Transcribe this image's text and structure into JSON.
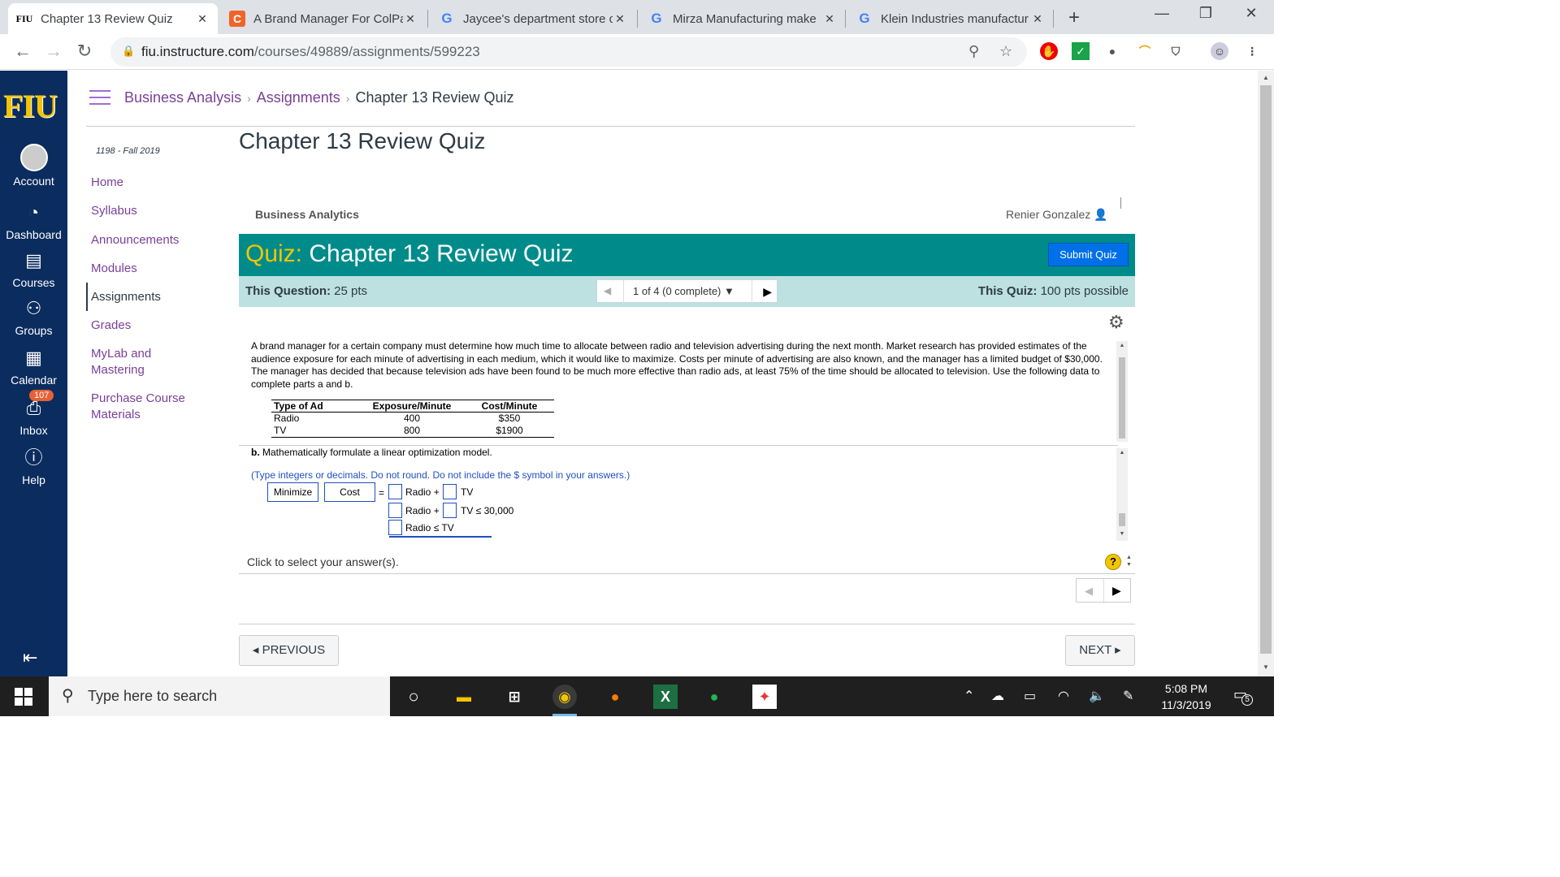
{
  "browser": {
    "tabs": [
      {
        "favicon": "FIU",
        "title": "Chapter 13 Review Quiz",
        "active": true
      },
      {
        "favicon": "C",
        "title": "A Brand Manager For ColPa",
        "active": false
      },
      {
        "favicon": "G",
        "title": "Jaycee's department store c",
        "active": false
      },
      {
        "favicon": "G",
        "title": "Mirza Manufacturing make",
        "active": false
      },
      {
        "favicon": "G",
        "title": "Klein Industries manufactur",
        "active": false
      }
    ],
    "close_glyph": "✕",
    "new_tab": "+",
    "url_host": "fiu.instructure.com",
    "url_path": "/courses/49889/assignments/599223"
  },
  "global_nav": {
    "logo": "FIU",
    "items": [
      {
        "label": "Account",
        "icon": "user-avatar-icon"
      },
      {
        "label": "Dashboard",
        "icon": "dashboard-icon"
      },
      {
        "label": "Courses",
        "icon": "courses-icon"
      },
      {
        "label": "Groups",
        "icon": "groups-icon"
      },
      {
        "label": "Calendar",
        "icon": "calendar-icon"
      },
      {
        "label": "Inbox",
        "icon": "inbox-icon",
        "badge": "107"
      },
      {
        "label": "Help",
        "icon": "help-icon"
      }
    ]
  },
  "breadcrumb": {
    "course": "Business Analysis",
    "section": "Assignments",
    "page": "Chapter 13 Review Quiz"
  },
  "course_nav": {
    "term": "1198 - Fall 2019",
    "items": [
      "Home",
      "Syllabus",
      "Announcements",
      "Modules",
      "Assignments",
      "Grades",
      "MyLab and Mastering",
      "Purchase Course Materials"
    ],
    "active": "Assignments"
  },
  "page_title": "Chapter 13 Review Quiz",
  "quiz": {
    "course_name": "Business Analytics",
    "user_name": "Renier Gonzalez",
    "label": "Quiz:",
    "title": "Chapter 13 Review Quiz",
    "submit_label": "Submit Quiz",
    "this_question_label": "This Question:",
    "this_question_value": "25 pts",
    "progress": "1 of 4 (0 complete)",
    "this_quiz_label": "This Quiz:",
    "this_quiz_value": "100 pts possible"
  },
  "question": {
    "text": "A brand manager for a certain company must determine how much time to allocate between radio and television advertising during the next month. Market research has provided estimates of the audience exposure for each minute of advertising in each medium, which it would like to maximize. Costs per minute of advertising are also known, and the manager has a limited budget of $30,000. The manager has decided that because television ads have been found to be much more effective than radio ads, at least 75% of the time should be allocated to television. Use the following data to complete parts a and b.",
    "table": {
      "headers": [
        "Type of Ad",
        "Exposure/Minute",
        "Cost/Minute"
      ],
      "rows": [
        [
          "Radio",
          "400",
          "$350"
        ],
        [
          "TV",
          "800",
          "$1900"
        ]
      ]
    },
    "part_b_label": "b.",
    "part_b_text": "Mathematically formulate a linear optimization model.",
    "instructions": "(Type integers or decimals. Do not round. Do not include the $ symbol in your answers.)",
    "objective_sense": "Minimize",
    "objective_name": "Cost",
    "eq": "=",
    "radio_plus": "Radio +",
    "tv": "TV",
    "tv_budget": "TV ≤ 30,000",
    "radio_le_tv": "Radio ≤ TV"
  },
  "footer": {
    "click_msg": "Click to select your answer(s).",
    "help": "?",
    "previous": "◂ PREVIOUS",
    "next": "NEXT ▸"
  },
  "taskbar": {
    "search_placeholder": "Type here to search",
    "time": "5:08 PM",
    "date": "11/3/2019",
    "notifications": "5"
  }
}
